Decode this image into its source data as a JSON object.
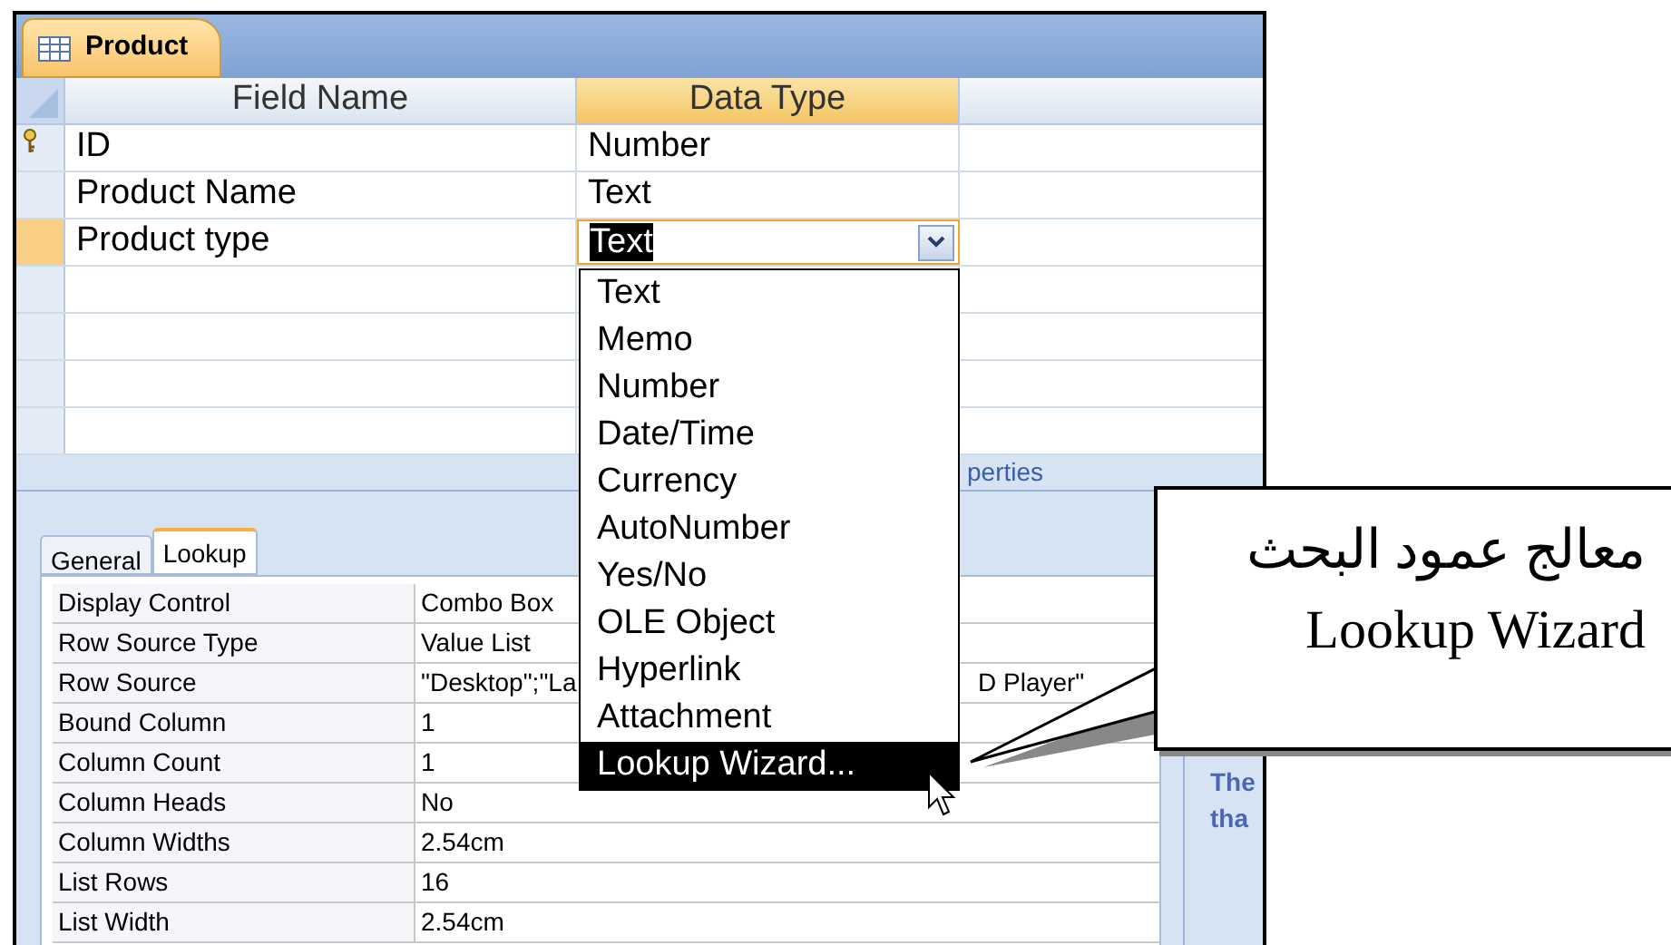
{
  "document_tab": {
    "label": "Product",
    "selected": true
  },
  "columns": [
    {
      "label": "Field Name",
      "selected": false
    },
    {
      "label": "Data Type",
      "selected": true
    }
  ],
  "fields": [
    {
      "name": "ID",
      "data_type": "Number",
      "primary_key": true,
      "selected": false
    },
    {
      "name": "Product Name",
      "data_type": "Text",
      "primary_key": false,
      "selected": false
    },
    {
      "name": "Product type",
      "data_type": "Text",
      "primary_key": false,
      "selected": true
    }
  ],
  "field_properties_label": "perties",
  "property_tabs": [
    {
      "label": "General",
      "selected": false
    },
    {
      "label": "Lookup",
      "selected": true
    }
  ],
  "properties": [
    {
      "name": "Display Control",
      "value": "Combo Box"
    },
    {
      "name": "Row Source Type",
      "value": "Value List"
    },
    {
      "name": "Row Source",
      "value": "\"Desktop\";\"La",
      "value_tail": "D Player\""
    },
    {
      "name": "Bound Column",
      "value": "1"
    },
    {
      "name": "Column Count",
      "value": "1"
    },
    {
      "name": "Column Heads",
      "value": "No"
    },
    {
      "name": "Column Widths",
      "value": "2.54cm"
    },
    {
      "name": "List Rows",
      "value": "16"
    },
    {
      "name": "List Width",
      "value": "2.54cm"
    }
  ],
  "help_lines": [
    "The",
    "tha"
  ],
  "dropdown": {
    "options": [
      {
        "label": "Text",
        "selected": false
      },
      {
        "label": "Memo",
        "selected": false
      },
      {
        "label": "Number",
        "selected": false
      },
      {
        "label": "Date/Time",
        "selected": false
      },
      {
        "label": "Currency",
        "selected": false
      },
      {
        "label": "AutoNumber",
        "selected": false
      },
      {
        "label": "Yes/No",
        "selected": false
      },
      {
        "label": "OLE Object",
        "selected": false
      },
      {
        "label": "Hyperlink",
        "selected": false
      },
      {
        "label": "Attachment",
        "selected": false
      },
      {
        "label": "Lookup Wizard...",
        "selected": true
      }
    ]
  },
  "callout": {
    "lines": [
      "معالج عمود البحث",
      "Lookup Wizard"
    ]
  }
}
